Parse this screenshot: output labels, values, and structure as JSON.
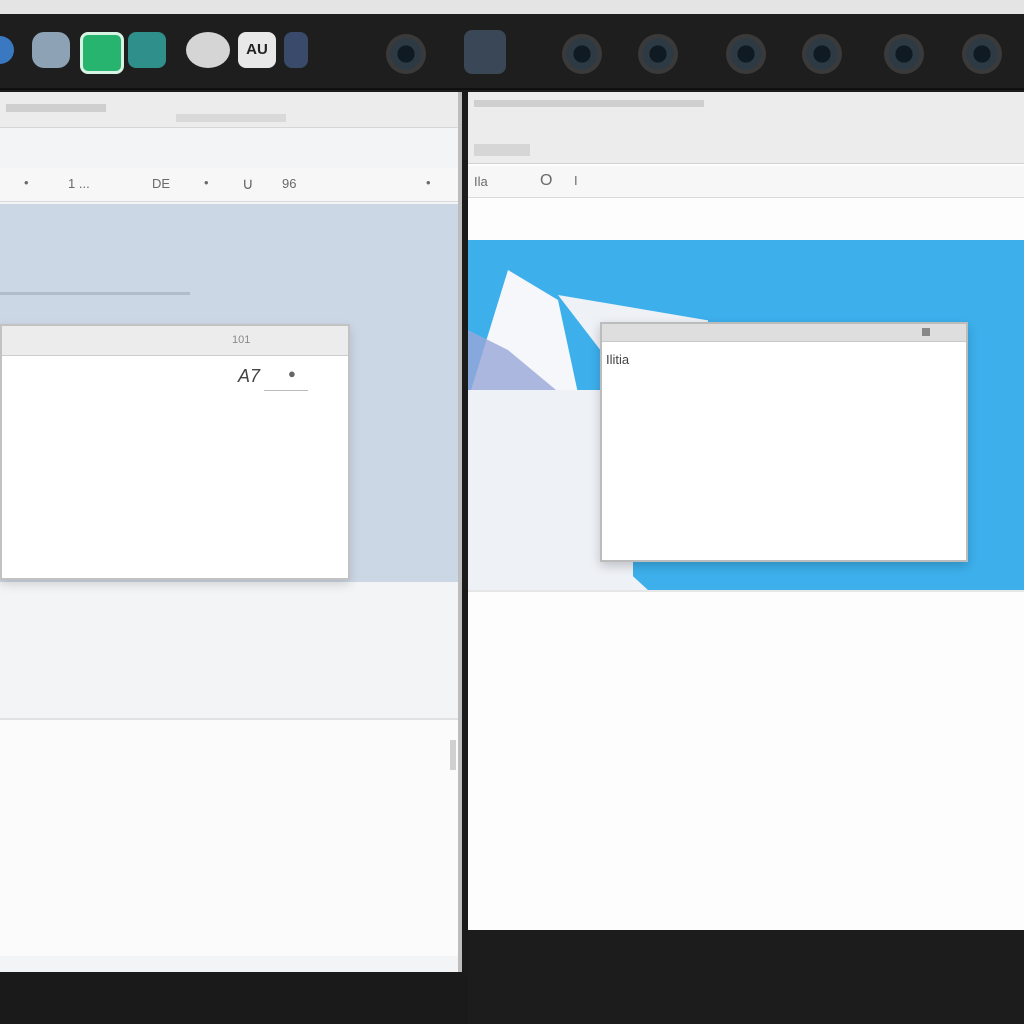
{
  "dock": {
    "items": [
      {
        "icon": "globe-icon",
        "color": "#3a78c2"
      },
      {
        "icon": "shield-icon",
        "color": "#8ea2b5"
      },
      {
        "icon": "chat-icon",
        "color": "#27b46e"
      },
      {
        "icon": "photos-icon",
        "color": "#2f8f8a"
      },
      {
        "icon": "disk-icon",
        "color": "#d5d5d5"
      },
      {
        "icon": "notes-icon",
        "color": "#e8e8e8",
        "glyph": "AU"
      },
      {
        "icon": "terminal-icon",
        "color": "#3a4a6a"
      },
      {
        "icon": "camera-icon"
      },
      {
        "icon": "tools-icon",
        "color": "#3a4756"
      },
      {
        "icon": "camera-icon"
      },
      {
        "icon": "camera-icon"
      },
      {
        "icon": "camera-icon"
      },
      {
        "icon": "camera-icon"
      },
      {
        "icon": "camera-icon"
      },
      {
        "icon": "camera-icon"
      }
    ]
  },
  "left_window": {
    "toolbar": {
      "item1": "1 ...",
      "item2": "DE",
      "item3": "∪",
      "item4": "96"
    },
    "dialog": {
      "label": "101",
      "glyph": "A7"
    }
  },
  "right_window": {
    "dialog": {
      "text": "Ilitia"
    },
    "toolbar": {
      "item1": "Ila",
      "item2": "O",
      "item3": "I"
    }
  },
  "colors": {
    "desktop": "#3db0ec",
    "canvas": "#ccd7e6"
  }
}
